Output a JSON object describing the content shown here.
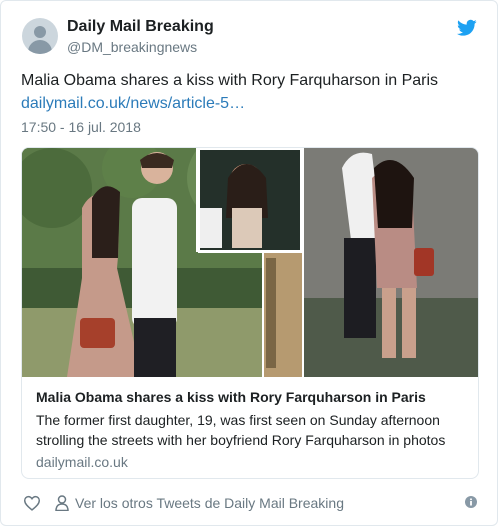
{
  "author": {
    "name": "Daily Mail Breaking",
    "handle": "@DM_breakingnews"
  },
  "tweet": {
    "text": "Malia Obama shares a kiss with Rory Farquharson in Paris",
    "link": "dailymail.co.uk/news/article-5…",
    "timestamp": "17:50 - 16 jul. 2018"
  },
  "card": {
    "image_desc": "photo-collage",
    "title": "Malia Obama shares a kiss with Rory Farquharson in Paris",
    "description": "The former first daughter, 19, was first seen on Sunday afternoon strolling the streets with her boyfriend Rory Farquharson in photos",
    "domain": "dailymail.co.uk"
  },
  "footer": {
    "more_tweets_label": "Ver los otros Tweets de Daily Mail Breaking"
  },
  "icons": {
    "bird": "twitter-bird-icon",
    "like": "heart-icon",
    "profile": "person-icon",
    "info": "info-icon"
  },
  "colors": {
    "twitter_blue": "#1da1f2",
    "link": "#2b7bb9",
    "muted": "#697882",
    "border": "#e1e8ed"
  }
}
